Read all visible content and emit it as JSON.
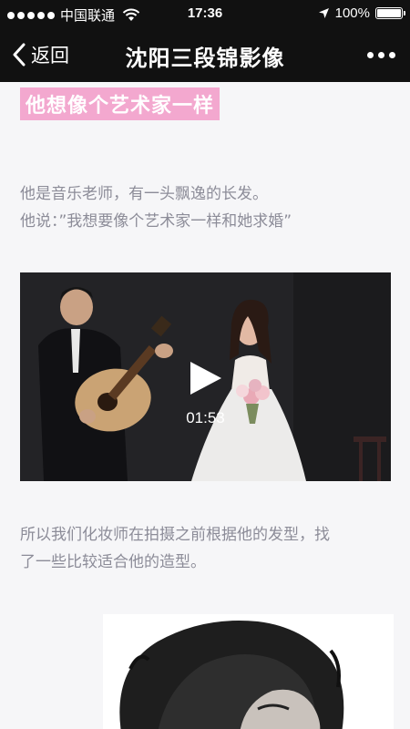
{
  "status_bar": {
    "carrier": "中国联通",
    "time": "17:36",
    "battery": "100%",
    "battery_level": 1.0,
    "signal_icon": "signal-dots",
    "wifi_icon": "wifi-icon",
    "location_icon": "location-arrow-icon"
  },
  "nav": {
    "back_label": "返回",
    "title": "沈阳三段锦影像",
    "more_icon": "more-dots-icon"
  },
  "article": {
    "heading": "他想像个艺术家一样",
    "heading_bg": "#f3a8cf",
    "paragraph1_lines": [
      "他是音乐老师，有一头飘逸的长发。",
      "他说：”我想要像个艺术家一样和她求婚”"
    ],
    "video": {
      "duration": "01:53",
      "play_icon": "play-icon"
    },
    "paragraph2_lines": [
      "所以我们化妆师在拍摄之前根据他的发型，找",
      "了一些比较适合他的造型。"
    ]
  },
  "colors": {
    "bar_background": "#111111",
    "page_background": "#f6f6f8",
    "body_text": "#8c8c98"
  }
}
